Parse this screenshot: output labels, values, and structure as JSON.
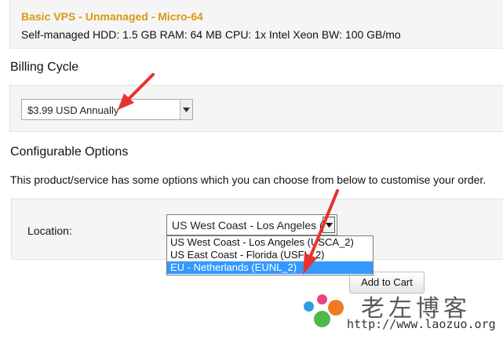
{
  "product": {
    "name": "Basic VPS - Unmanaged - Micro-64",
    "specs": "Self-managed HDD: 1.5 GB RAM: 64 MB CPU: 1x Intel Xeon BW: 100 GB/mo"
  },
  "billing": {
    "title": "Billing Cycle",
    "selected": "$3.99 USD Annually"
  },
  "config": {
    "title": "Configurable Options",
    "description": "This product/service has some options which you can choose from below to customise your order.",
    "location_label": "Location:",
    "location_selected": "US West Coast - Los Angeles (U",
    "location_options": [
      "US West Coast - Los Angeles (USCA_2)",
      "US East Coast - Florida (USFL_2)",
      "EU - Netherlands (EUNL_2)"
    ],
    "highlighted_option_index": 2
  },
  "cart": {
    "add_label": "Add to Cart"
  },
  "watermark": {
    "title": "老左博客",
    "url": "http://www.laozuo.org"
  },
  "icons": {
    "select_arrow": "chevron-down-icon",
    "annotation": "red-arrow-icon"
  },
  "colors": {
    "product_name": "#d99a12",
    "highlight": "#3399ff",
    "annotation_arrow": "#e8322c",
    "panel_bg": "#f5f5f5"
  }
}
